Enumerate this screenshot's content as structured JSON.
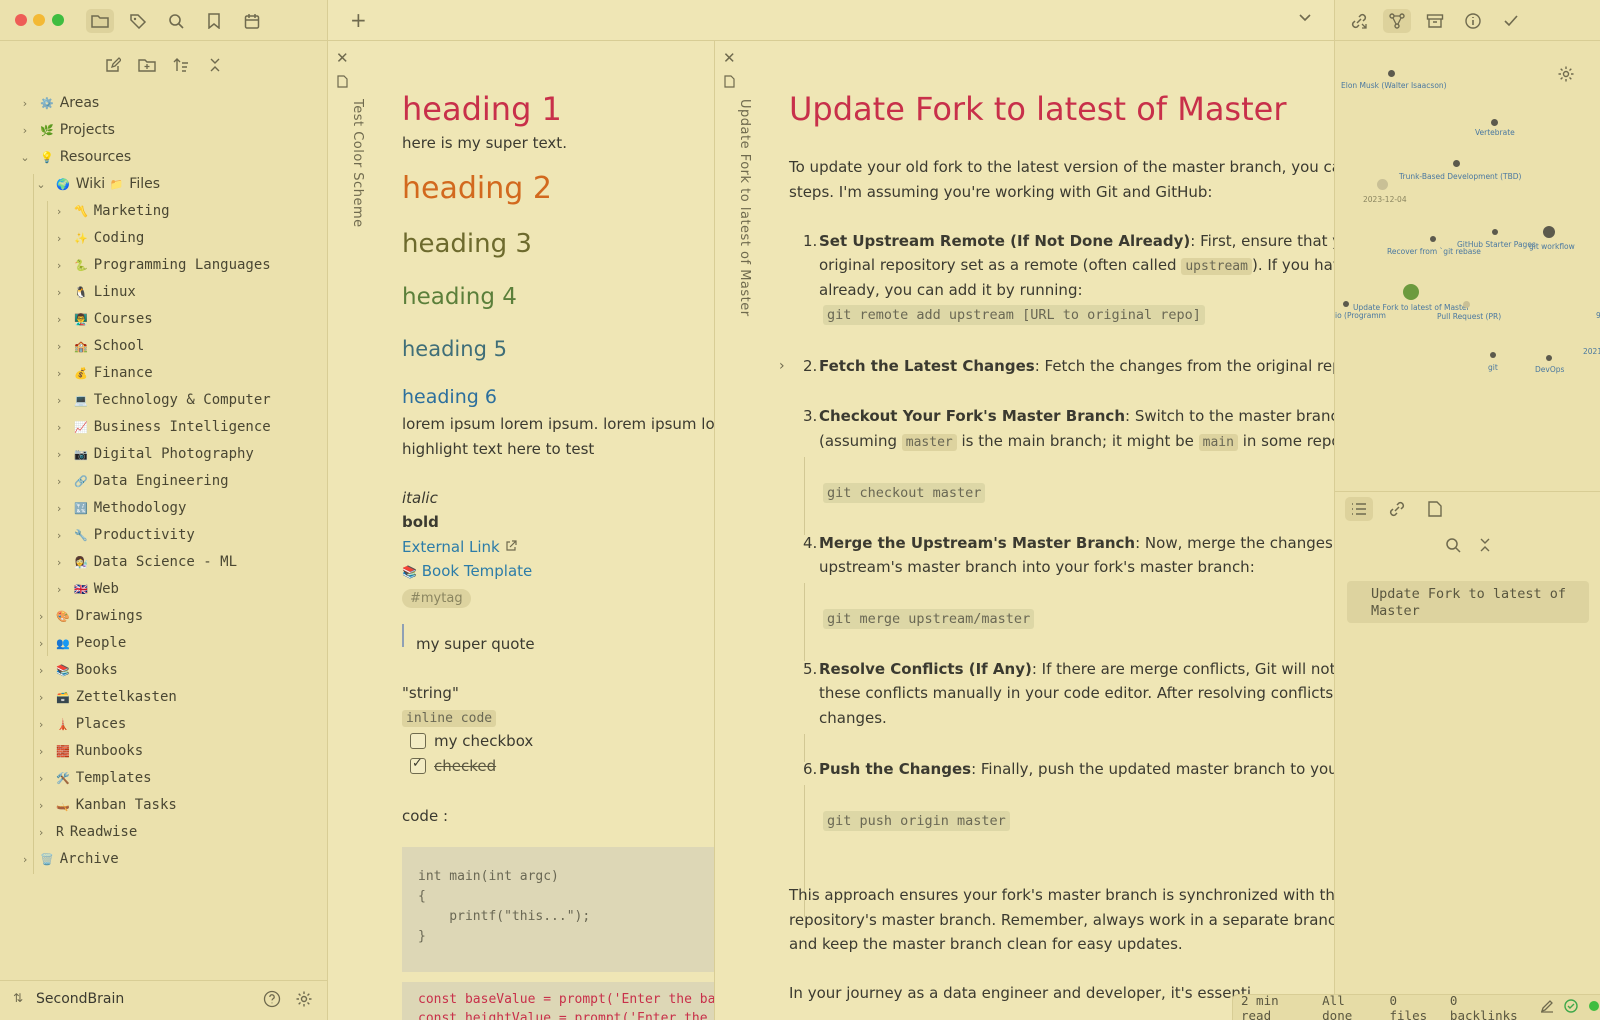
{
  "window": {
    "top_left_icons": [
      "folder-icon",
      "tags-icon",
      "search-icon",
      "bookmark-icon",
      "calendar-icon"
    ],
    "new_tab_label": "+",
    "right_toolbar_icons": [
      "backlinks-icon",
      "graph-icon",
      "archive-icon",
      "info-icon",
      "check-icon"
    ]
  },
  "sidebar": {
    "tools": [
      "new-note-icon",
      "new-folder-icon",
      "sort-icon",
      "collapse-icon"
    ],
    "tree": [
      {
        "label": "Areas",
        "emoji": "⚙️"
      },
      {
        "label": "Projects",
        "emoji": "🌿"
      },
      {
        "label": "Resources",
        "emoji": "💡"
      },
      {
        "label": "Wiki",
        "emoji": "🌍",
        "suffix": "Files",
        "suffix_emoji": "📁"
      },
      {
        "label": "Marketing",
        "emoji": "〽️"
      },
      {
        "label": "Coding",
        "emoji": "✨"
      },
      {
        "label": "Programming Languages",
        "emoji": "🐍"
      },
      {
        "label": "Linux",
        "emoji": "🐧"
      },
      {
        "label": "Courses",
        "emoji": "👨‍🏫"
      },
      {
        "label": "School",
        "emoji": "🏫"
      },
      {
        "label": "Finance",
        "emoji": "💰"
      },
      {
        "label": "Technology & Computer",
        "emoji": "💻"
      },
      {
        "label": "Business Intelligence",
        "emoji": "📈"
      },
      {
        "label": "Digital Photography",
        "emoji": "📷"
      },
      {
        "label": "Data Engineering",
        "emoji": "🔗"
      },
      {
        "label": "Methodology",
        "emoji": "🔣"
      },
      {
        "label": "Productivity",
        "emoji": "🔧"
      },
      {
        "label": "Data Science - ML",
        "emoji": "👩‍🔬"
      },
      {
        "label": "Web",
        "emoji": "🇬🇧"
      },
      {
        "label": "Drawings",
        "emoji": "🎨"
      },
      {
        "label": "People",
        "emoji": "👥"
      },
      {
        "label": "Books",
        "emoji": "📚"
      },
      {
        "label": "Zettelkasten",
        "emoji": "🗃️"
      },
      {
        "label": "Places",
        "emoji": "🗼"
      },
      {
        "label": "Runbooks",
        "emoji": "🧱"
      },
      {
        "label": "Templates",
        "emoji": "🛠️"
      },
      {
        "label": "Kanban Tasks",
        "emoji": "🛶"
      },
      {
        "label": "Readwise",
        "emoji": "R"
      },
      {
        "label": "Archive",
        "emoji": "🗑️"
      }
    ],
    "vault_name": "SecondBrain"
  },
  "pane1": {
    "tab_title": "Test Color Scheme",
    "h1": "heading 1",
    "p1": "here is my super text.",
    "h2": "heading 2",
    "h3": "heading 3",
    "h4": "heading 4",
    "h5": "heading 5",
    "h6": "heading 6",
    "lorem": "lorem ipsum lorem ipsum. lorem ipsum lorem",
    "highlight": "highlight text here to test",
    "italic": "italic",
    "bold": "bold",
    "external_link": "External Link",
    "book_template_emoji": "📚",
    "book_template": "Book Template",
    "tag": "#mytag",
    "quote": "my super quote",
    "string": "\"string\"",
    "inline_code": "inline code",
    "checkbox1": "my checkbox",
    "checkbox2": "checked",
    "code_label": "code :",
    "code_lines": [
      "int main(int argc)",
      "{",
      "    printf(\"this...\");",
      "}"
    ],
    "code2_lines": [
      "const baseValue = prompt('Enter the base",
      "const heightValue = prompt('Enter the hei"
    ]
  },
  "pane2": {
    "tab_title": "Update Fork to latest of Master",
    "title": "Update Fork to latest of Master",
    "intro1": "To update your old fork to the latest version of the master branch, you can fo",
    "intro2": "steps. I'm assuming you're working with Git and GitHub:",
    "steps": [
      {
        "num": "1.",
        "bold": "Set Upstream Remote (If Not Done Already)",
        "rest": ": First, ensure that you h",
        "line2a": "original repository set as a remote (often called ",
        "line2code": "upstream",
        "line2b": "). If you haven'",
        "line3": "already, you can add it by running:",
        "code": "git remote add upstream [URL to original repo]"
      },
      {
        "num": "2.",
        "bold": "Fetch the Latest Changes",
        "rest": ": Fetch the changes from the original reposi"
      },
      {
        "num": "3.",
        "bold": "Checkout Your Fork's Master Branch",
        "rest": ": Switch to the master branch of",
        "line2a": "(assuming ",
        "line2code": "master",
        "line2b": " is the main branch; it might be ",
        "line2code2": "main",
        "line2c": " in some repos):",
        "code": "git checkout master"
      },
      {
        "num": "4.",
        "bold": "Merge the Upstream's Master Branch",
        "rest": ": Now, merge the changes from",
        "line2": "upstream's master branch into your fork's master branch:",
        "code": "git merge upstream/master"
      },
      {
        "num": "5.",
        "bold": "Resolve Conflicts (If Any)",
        "rest": ": If there are merge conflicts, Git will notify",
        "line2": "these conflicts manually in your code editor. After resolving conflicts, co",
        "line3": "changes."
      },
      {
        "num": "6.",
        "bold": "Push the Changes",
        "rest": ": Finally, push the updated master branch to your fo",
        "code": "git push origin master"
      }
    ],
    "outro1": "This approach ensures your fork's master branch is synchronized with the u",
    "outro2": "repository's master branch. Remember, always work in a separate branch fo",
    "outro3": "and keep the master branch clean for easy updates.",
    "outro4": "In your journey as a data engineer and developer, it's essenti"
  },
  "graph": {
    "labels": [
      "Elon Musk (Walter Isaacson)",
      "Vertebrate",
      "Trunk-Based Development (TBD)",
      "2023-12-04",
      "Recover from `git rebase",
      "GitHub Starter Pages",
      "git workflow",
      "Update Fork to latest of Master",
      "Pull Request (PR)",
      "io (Programm",
      "git",
      "DevOps",
      "2021",
      "9"
    ]
  },
  "outline": {
    "item": "Update Fork to latest of Master"
  },
  "status": {
    "read_time": "2 min read",
    "sync": "All done",
    "files": "0 files",
    "backlinks": "0 backlinks"
  }
}
